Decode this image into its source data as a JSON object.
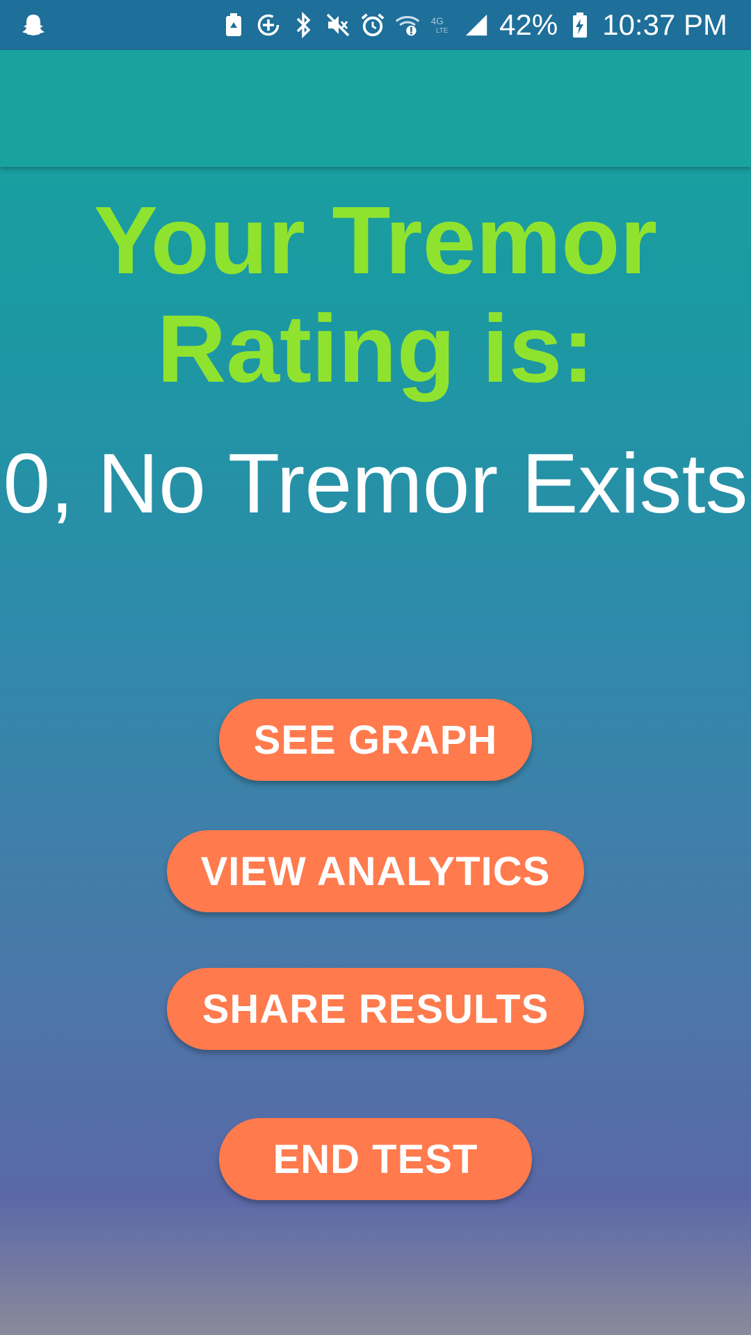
{
  "status_bar": {
    "battery_percent": "42%",
    "time": "10:37 PM",
    "icons": [
      "ghost-icon",
      "battery-saver-icon",
      "data-saver-icon",
      "bluetooth-icon",
      "mute-icon",
      "alarm-icon",
      "wifi-icon",
      "4g-lte-icon",
      "signal-icon",
      "battery-charging-icon"
    ],
    "background_color": "#1e6f99"
  },
  "app_bar": {
    "background_color": "#19a39e"
  },
  "result": {
    "title": "Your Tremor Rating is:",
    "title_color": "#8fe32e",
    "rating_text": "0, No Tremor Exists"
  },
  "actions": {
    "see_graph": "SEE GRAPH",
    "view_analytics": "VIEW ANALYTICS",
    "share_results": "SHARE RESULTS",
    "end_test": "END TEST",
    "button_color": "#ff7a4d"
  }
}
